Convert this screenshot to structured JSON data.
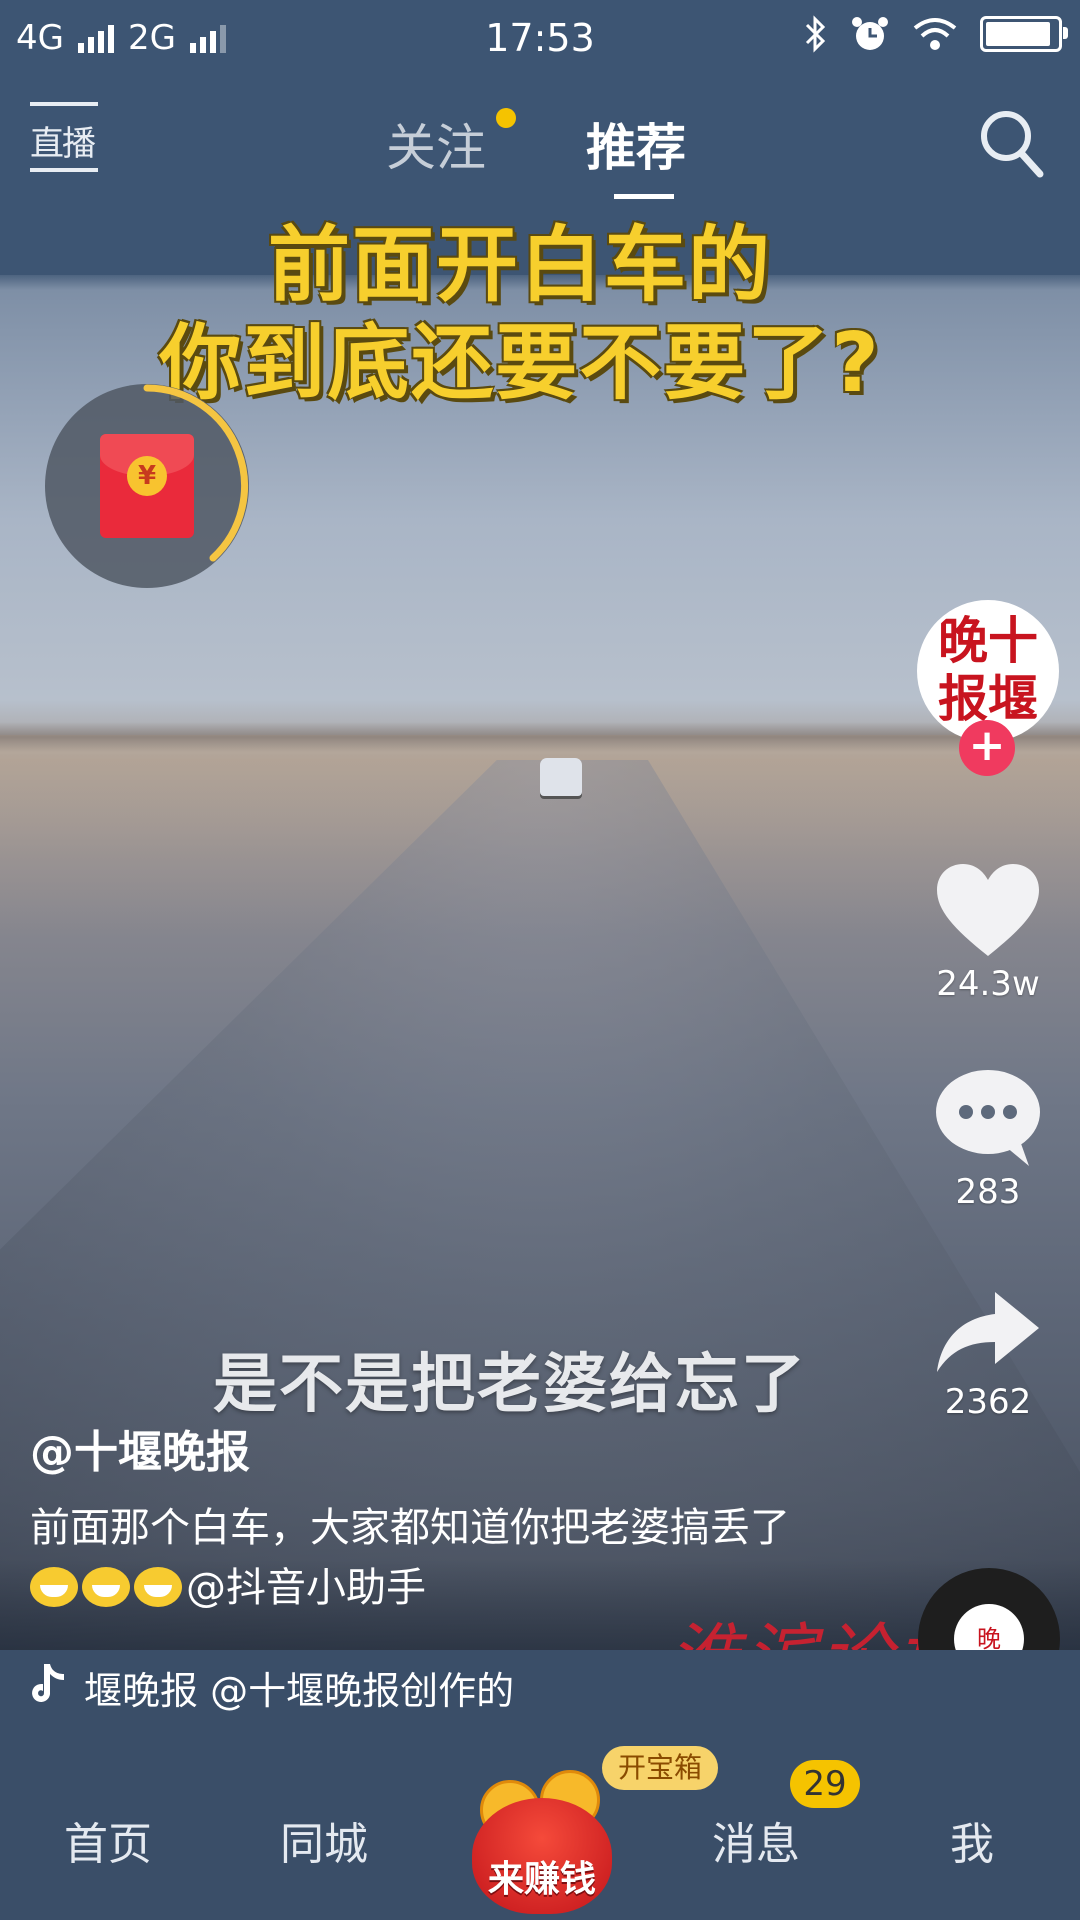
{
  "status_bar": {
    "network1": "4G",
    "network2": "2G",
    "time": "17:53"
  },
  "top_nav": {
    "live_label": "直播",
    "tabs": [
      {
        "label": "关注"
      },
      {
        "label": "推荐"
      }
    ]
  },
  "video": {
    "title_line1": "前面开白车的",
    "title_line2": "你到底还要不要了?",
    "subtitle": "是不是把老婆给忘了",
    "watermark": "淮滨论坛"
  },
  "actions": {
    "avatar_text": "晚十 报堰",
    "likes": "24.3w",
    "comments": "283",
    "shares": "2362"
  },
  "post": {
    "author": "@十堰晚报",
    "description_part1": "前面那个白车，大家都知道你把老婆搞丢了",
    "description_part2": "@抖音小助手"
  },
  "music": {
    "text": "堰晚报    @十堰晚报创作的"
  },
  "bottom_nav": {
    "home": "首页",
    "city": "同城",
    "earn": "来赚钱",
    "chest": "开宝箱",
    "messages": "消息",
    "messages_badge": "29",
    "me": "我"
  },
  "colors": {
    "accent_yellow": "#f5c300",
    "follow_pink": "#f03a5f",
    "nav_bg": "#3a4e68"
  }
}
